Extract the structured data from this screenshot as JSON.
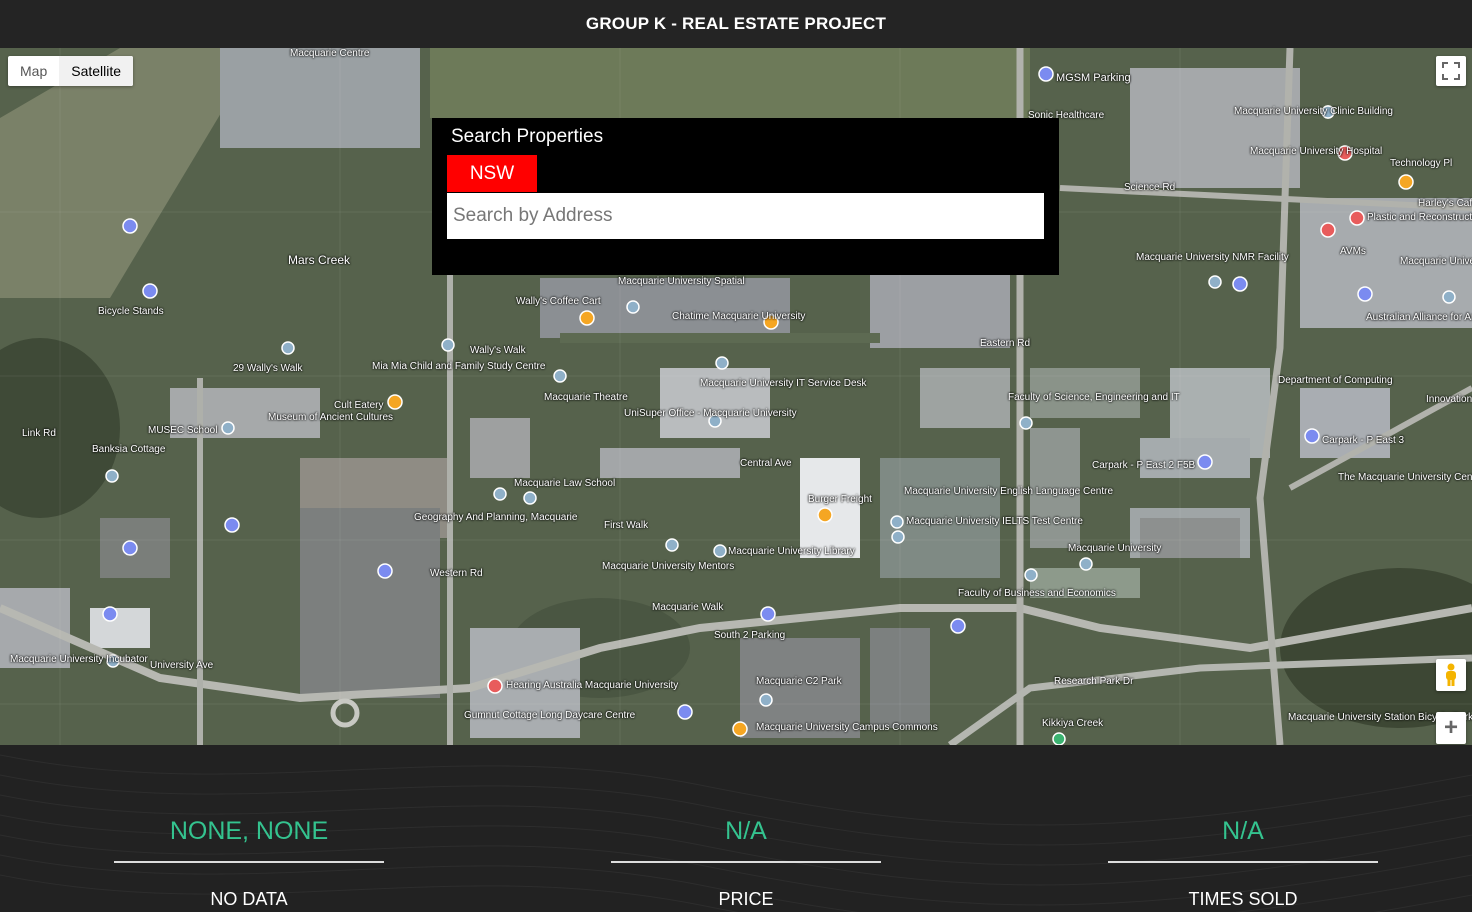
{
  "header": {
    "title": "GROUP K - REAL ESTATE PROJECT"
  },
  "map_controls": {
    "map_label": "Map",
    "satellite_label": "Satellite",
    "active_type": "Satellite",
    "fullscreen_icon": "fullscreen-icon",
    "pegman_icon": "pegman-icon",
    "zoom_in_label": "+"
  },
  "map_labels": [
    "Macquarie Centre",
    "MGSM Parking",
    "Sonic Healthcare",
    "Macquarie University Clinic Building",
    "Macquarie University Hospital",
    "Technology Pl",
    "Harley's Cafe",
    "Plastic and Reconstructive Surgery",
    "AVMs",
    "Macquarie University NMR Facility",
    "Macquarie University Info",
    "Australian Alliance for Artificial Intelligence",
    "Wally's Walk",
    "Mars Creek",
    "Bicycle Stands",
    "Wally's Coffee Cart",
    "Macquarie University Spatial",
    "Chatime Macquarie University",
    "Mia Mia Child and Family Study Centre",
    "29 Wally's Walk",
    "Macquarie Theatre",
    "Macquarie University IT Service Desk",
    "UniSuper Office - Macquarie University",
    "Cult Eatery",
    "Museum of Ancient Cultures",
    "MUSEC School",
    "Banksia Cottage",
    "Faculty of Science, Engineering and IT",
    "Department of Computing",
    "Carpark - P East 3",
    "Carpark - P East 2 F5B",
    "The Macquarie University Centre for",
    "Macquarie University English Language Centre",
    "Macquarie University IELTS Test Centre",
    "Burger Freight",
    "Macquarie Law School",
    "Geography And Planning, Macquarie",
    "First Walk",
    "Macquarie University Library",
    "Macquarie University Mentors",
    "Macquarie University",
    "Faculty of Business and Economics",
    "Macquarie Walk",
    "South 2 Parking",
    "Macquarie C2 Park",
    "Hearing Australia Macquarie University",
    "Gumnut Cottage Long Daycare Centre",
    "Macquarie University Campus Commons",
    "Macquarie University Incubator",
    "Kikkiya Creek",
    "Macquarie University Station Bicycle Parking",
    "Research Park Dr",
    "Science Rd",
    "Eastern Rd",
    "Link Rd",
    "Western Rd",
    "Central Ave",
    "University Ave",
    "Innovation"
  ],
  "search": {
    "title": "Search Properties",
    "state_button": "NSW",
    "placeholder": "Search by Address",
    "value": ""
  },
  "stats": [
    {
      "value": "NONE, NONE",
      "label": "NO DATA"
    },
    {
      "value": "N/A",
      "label": "PRICE"
    },
    {
      "value": "N/A",
      "label": "TIMES SOLD"
    }
  ],
  "colors": {
    "accent_green": "#34c38f",
    "state_red": "#ff0000",
    "panel_black": "#000000"
  }
}
